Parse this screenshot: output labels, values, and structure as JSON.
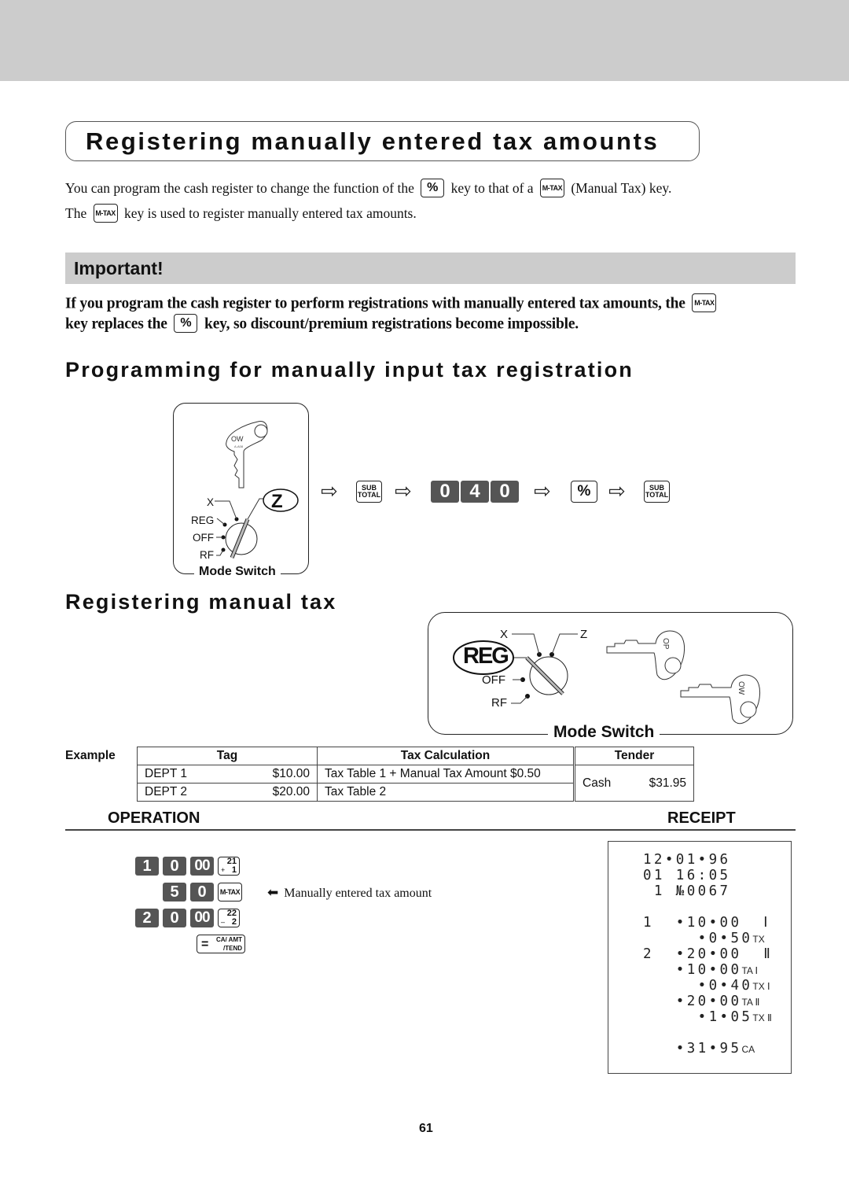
{
  "page": {
    "title": "Registering manually entered tax amounts",
    "page_number": "61",
    "colors": {
      "band": "#cccccc",
      "dark_key": "#555555",
      "text": "#111111"
    }
  },
  "intro": {
    "line1_a": "You can program the cash register to change the function of the",
    "line1_b": "key to that of a",
    "line1_c": "(Manual Tax) key.",
    "line2_a": "The",
    "line2_b": "key is used to register manually entered tax amounts."
  },
  "keys": {
    "percent": "%",
    "mtax": "M-TAX",
    "sub_total_top": "SUB",
    "sub_total_bottom": "TOTAL",
    "cash_eq": "=",
    "cash_top": "CA/ AMT",
    "cash_bottom": "/TEND"
  },
  "important": {
    "label": "Important!",
    "line1_a": "If you program the cash register to perform registrations with manually entered tax amounts, the",
    "line2_a": "key replaces the",
    "line2_b": "key, so discount/premium registrations become impossible."
  },
  "section_programming": {
    "title": "Programming for manually input tax registration",
    "mode_switch": {
      "caption": "Mode Switch",
      "key_label": "OW",
      "positions": [
        "X",
        "REG",
        "OFF",
        "RF"
      ],
      "selected": "Z"
    },
    "sequence": [
      "arrow",
      "SUB TOTAL",
      "arrow",
      "0",
      "4",
      "0",
      "arrow",
      "%",
      "arrow",
      "SUB TOTAL"
    ]
  },
  "section_register": {
    "title": "Registering manual tax",
    "mode_switch": {
      "caption": "Mode Switch",
      "selected": "REG",
      "positions": [
        "X",
        "Z",
        "OFF",
        "RF"
      ],
      "keys": [
        "OP",
        "OW"
      ]
    }
  },
  "example": {
    "label": "Example",
    "headers": [
      "Tag",
      "Tax Calculation",
      "Tender"
    ],
    "rows": [
      {
        "dept": "DEPT 1",
        "amount": "$10.00",
        "calc": "Tax Table 1 + Manual Tax Amount $0.50"
      },
      {
        "dept": "DEPT 2",
        "amount": "$20.00",
        "calc": "Tax Table 2"
      }
    ],
    "tender": {
      "method": "Cash",
      "amount": "$31.95"
    }
  },
  "operation": {
    "label": "OPERATION",
    "rows": [
      {
        "digits": [
          "1",
          "0",
          "00"
        ],
        "dept_top": "21",
        "dept_sign": "+",
        "dept_bottom": "1"
      },
      {
        "digits": [
          "5",
          "0"
        ],
        "key": "M-TAX",
        "annotation": "Manually entered tax amount"
      },
      {
        "digits": [
          "2",
          "0",
          "00"
        ],
        "dept_top": "22",
        "dept_sign": "–",
        "dept_bottom": "2"
      }
    ]
  },
  "receipt": {
    "label": "RECEIPT",
    "lines": [
      {
        "text": "12•01•96",
        "sfx": ""
      },
      {
        "text": "01 16:05",
        "sfx": ""
      },
      {
        "text": " 1 №0067",
        "sfx": ""
      },
      {
        "text": "",
        "sfx": ""
      },
      {
        "text": "1  •10•00  Ⅰ",
        "sfx": ""
      },
      {
        "text": "     •0•50",
        "sfx": "TX"
      },
      {
        "text": "2  •20•00  Ⅱ",
        "sfx": ""
      },
      {
        "text": "   •10•00",
        "sfx": "TA Ⅰ"
      },
      {
        "text": "     •0•40",
        "sfx": "TX Ⅰ"
      },
      {
        "text": "   •20•00",
        "sfx": "TA Ⅱ"
      },
      {
        "text": "     •1•05",
        "sfx": "TX Ⅱ"
      },
      {
        "text": "",
        "sfx": ""
      },
      {
        "text": "   •31•95",
        "sfx": "CA"
      }
    ]
  }
}
